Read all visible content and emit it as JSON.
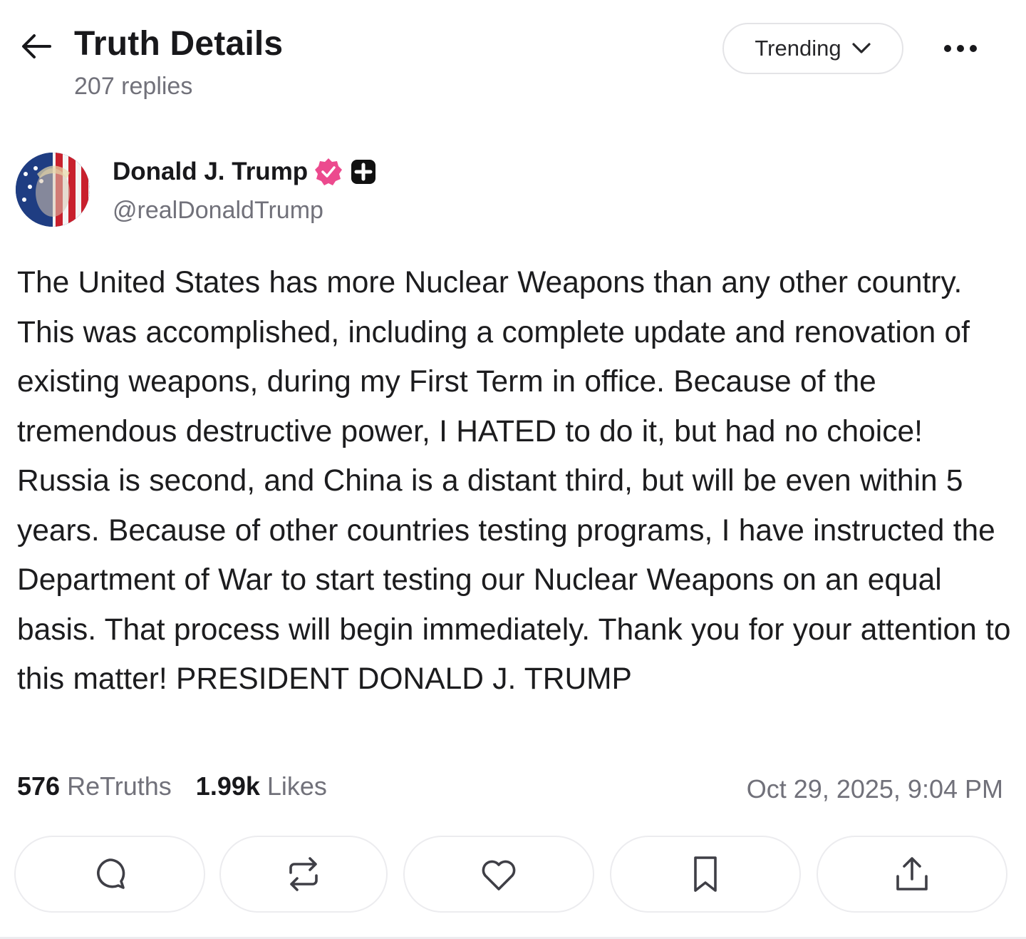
{
  "header": {
    "title": "Truth Details",
    "replies": "207 replies",
    "sort_label": "Trending",
    "icons": {
      "back": "arrow-left-icon",
      "sort": "chevron-down-icon",
      "more": "more-horizontal-icon"
    }
  },
  "author": {
    "name": "Donald J. Trump",
    "handle": "@realDonaldTrump",
    "verified_badge": "verified-badge-icon",
    "verified_color": "#ec4a8e",
    "plus_badge": "plus-badge-icon"
  },
  "post": {
    "text": "The United States has more Nuclear Weapons than any other country. This was accomplished, including a complete update and renovation of existing weapons, during my First Term in office. Because of the tremendous destructive power, I HATED to do it, but had no choice! Russia is second, and China is a distant third, but will be even within 5 years. Because of other countries testing programs, I have instructed the Department of War to start testing our Nuclear Weapons on an equal basis. That process will begin immediately. Thank you for your attention to this matter! PRESIDENT DONALD J. TRUMP"
  },
  "stats": {
    "retruths_count": "576",
    "retruths_label": "ReTruths",
    "likes_count": "1.99k",
    "likes_label": "Likes",
    "timestamp": "Oct 29, 2025, 9:04 PM"
  },
  "actions": [
    {
      "name": "reply",
      "icon": "comment-icon"
    },
    {
      "name": "retruth",
      "icon": "repost-icon"
    },
    {
      "name": "like",
      "icon": "heart-icon"
    },
    {
      "name": "bookmark",
      "icon": "bookmark-icon"
    },
    {
      "name": "share",
      "icon": "share-icon"
    }
  ],
  "colors": {
    "text": "#1c1c1e",
    "muted": "#71717a",
    "border": "#ececef",
    "accent": "#ec4a8e"
  }
}
